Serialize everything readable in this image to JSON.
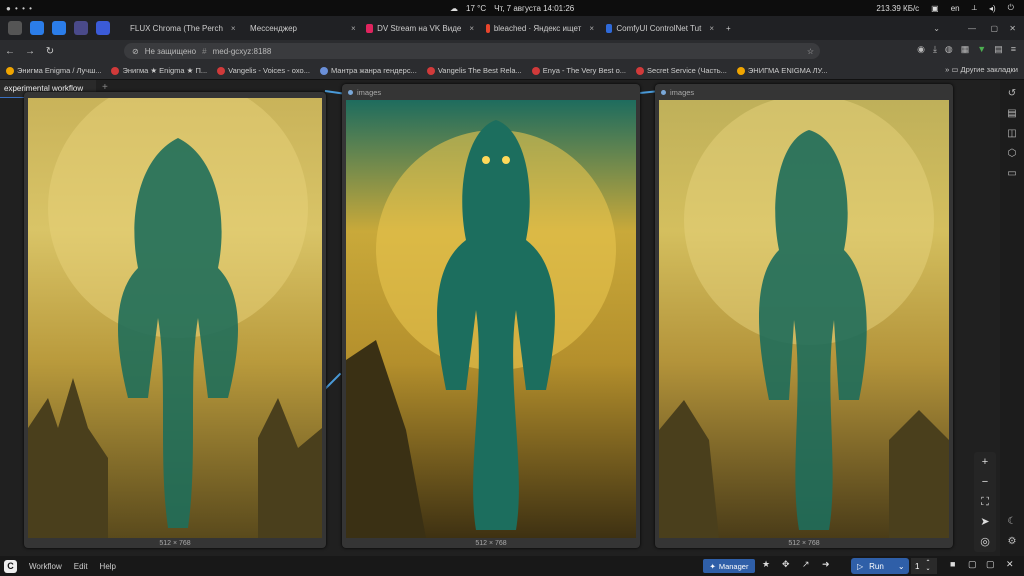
{
  "system_bar": {
    "temp": "17 °C",
    "datetime": "Чт, 7 августа 14:01:26",
    "net_speed": "213.39 КБ/с",
    "lang": "en"
  },
  "tabs": [
    {
      "label": "FLUX Chroma (The Perch",
      "color": "#c9a227"
    },
    {
      "label": "Мессенджер",
      "color": "#2b7de9"
    },
    {
      "label": "DV Stream на VK Виде",
      "color": "#e0245e"
    },
    {
      "label": "bleached · Яндекс ищет",
      "color": "#e8452c"
    },
    {
      "label": "ComfyUI ControlNet Tut",
      "color": "#2f6ad9"
    }
  ],
  "address": {
    "placeholder_text": "Не защищено",
    "url": "med-gcxyz:8188"
  },
  "bookmarks": [
    {
      "label": "Энигма Enigma / Лучш...",
      "color": "#f0a500"
    },
    {
      "label": "Энигма ★ Enigma ★ П...",
      "color": "#d13a3a"
    },
    {
      "label": "Vangelis - Voices - охо...",
      "color": "#d13a3a"
    },
    {
      "label": "Мантра жанра гендерс...",
      "color": "#6a8fd8"
    },
    {
      "label": "Vangelis The Best Rela...",
      "color": "#d13a3a"
    },
    {
      "label": "Enya - The Very Best o...",
      "color": "#d13a3a"
    },
    {
      "label": "Secret Service (Часть...",
      "color": "#d13a3a"
    },
    {
      "label": "ЭНИГМА ENIGMA ЛУ...",
      "color": "#f0a500"
    }
  ],
  "bookmarks_other": "Другие закладки",
  "workflow_tab": "experimental workflow",
  "nodes": [
    {
      "title": "",
      "footer": "512 × 768"
    },
    {
      "title": "images",
      "footer": "512 × 768"
    },
    {
      "title": "images",
      "footer": "512 × 768"
    }
  ],
  "bottom": {
    "menu": [
      "Workflow",
      "Edit",
      "Help"
    ],
    "manager": "Manager",
    "run": "Run",
    "queue_count": "1"
  },
  "colors": {
    "accent": "#2f5fa8",
    "link": "#4a9ad8"
  }
}
